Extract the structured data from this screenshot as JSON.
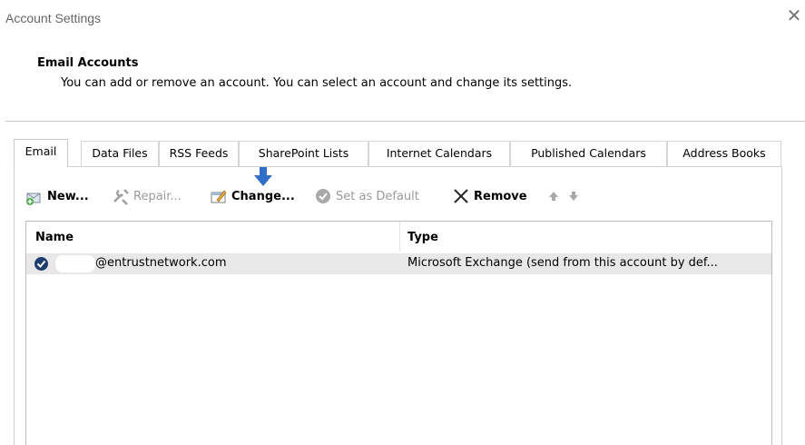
{
  "window": {
    "title": "Account Settings",
    "close_glyph": "✕"
  },
  "section": {
    "heading": "Email Accounts",
    "description": "You can add or remove an account. You can select an account and change its settings."
  },
  "tabs": [
    {
      "label": "Email",
      "active": true
    },
    {
      "label": "Data Files",
      "active": false
    },
    {
      "label": "RSS Feeds",
      "active": false
    },
    {
      "label": "SharePoint Lists",
      "active": false
    },
    {
      "label": "Internet Calendars",
      "active": false
    },
    {
      "label": "Published Calendars",
      "active": false
    },
    {
      "label": "Address Books",
      "active": false
    }
  ],
  "toolbar": {
    "new_label": "New...",
    "repair_label": "Repair...",
    "change_label": "Change...",
    "set_default_label": "Set as Default",
    "remove_label": "Remove"
  },
  "list": {
    "columns": [
      "Name",
      "Type"
    ],
    "rows": [
      {
        "name": "@entrustnetwork.com",
        "type": "Microsoft Exchange (send from this account by def..."
      }
    ]
  },
  "colors": {
    "callout_arrow": "#2f6fc9",
    "selected_row": "#e8e8e8",
    "check_badge": "#1f3e6e"
  }
}
